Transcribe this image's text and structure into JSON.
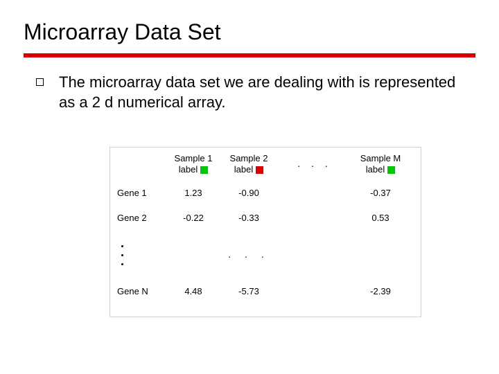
{
  "title": "Microarray Data Set",
  "body_text": "The microarray data set we are dealing with is represented as a 2 d numerical array.",
  "table": {
    "col_headers": [
      {
        "name": "Sample 1",
        "label_text": "label",
        "swatch": "green"
      },
      {
        "name": "Sample 2",
        "label_text": "label",
        "swatch": "red"
      },
      {
        "name": "Sample M",
        "label_text": "label",
        "swatch": "green"
      }
    ],
    "header_ellipsis": ". . .",
    "row_labels": [
      "Gene 1",
      "Gene 2",
      "Gene N"
    ],
    "center_ellipsis": ". . .",
    "cells": {
      "r1c1": "1.23",
      "r1c2": "-0.90",
      "r1cM": "-0.37",
      "r2c1": "-0.22",
      "r2c2": "-0.33",
      "r2cM": "0.53",
      "rNc1": "4.48",
      "rNc2": "-5.73",
      "rNcM": "-2.39"
    }
  }
}
